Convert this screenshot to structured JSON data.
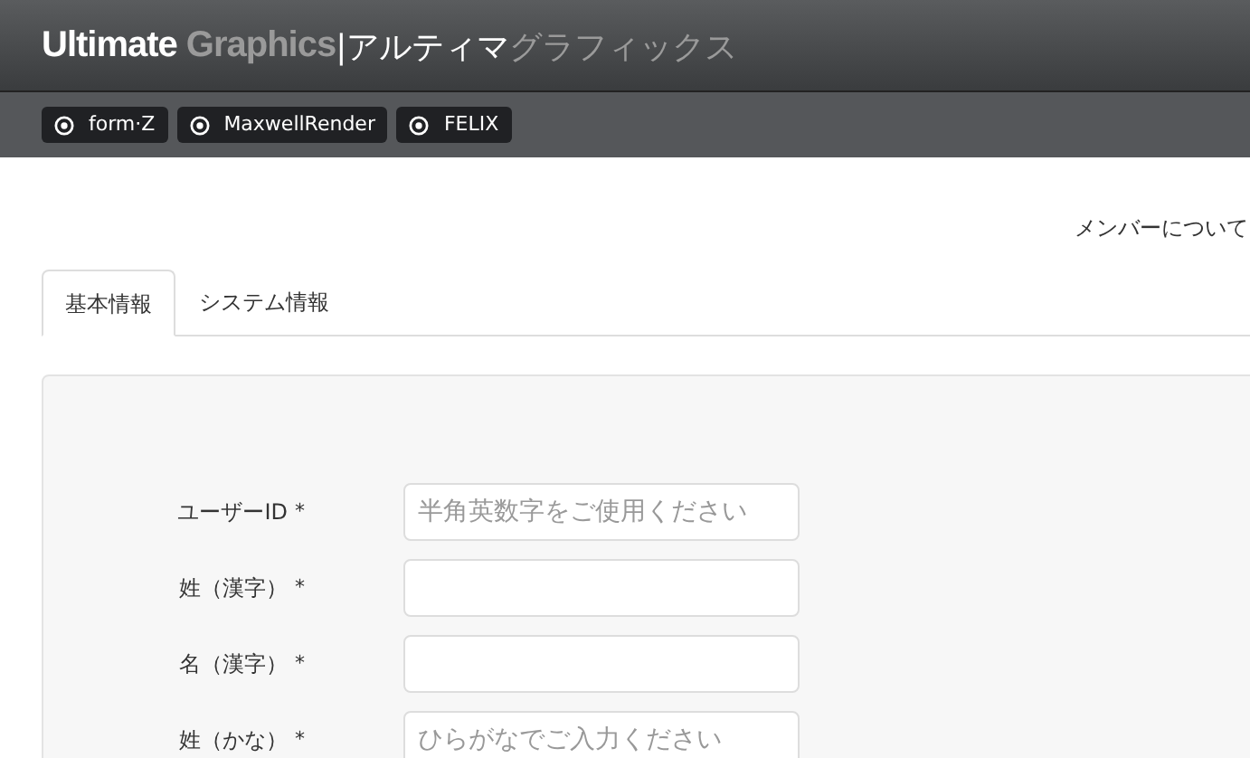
{
  "logo": [
    {
      "text": "Ultimate",
      "color": "#ffffff"
    },
    {
      "text": "Graphics",
      "color": "#9a9a9a"
    },
    {
      "text": "|",
      "color": "#ffffff"
    },
    {
      "text": "アルティマ",
      "color": "#ffffff"
    },
    {
      "text": "グラフィックス",
      "color": "#9a9a9a"
    }
  ],
  "nav": [
    {
      "label": "form·Z"
    },
    {
      "label": "MaxwellRender"
    },
    {
      "label": "FELIX"
    }
  ],
  "top_link": "メンバーについて",
  "tabs": [
    {
      "label": "基本情報",
      "selected": true
    },
    {
      "label": "システム情報",
      "selected": false
    }
  ],
  "fields": [
    {
      "label": "ユーザーID",
      "mark": "*",
      "placeholder": "半角英数字をご使用ください"
    },
    {
      "label": "姓（漢字）",
      "mark": "*"
    },
    {
      "label": "名（漢字）",
      "mark": "*"
    },
    {
      "label": "姓（かな）",
      "mark": "*",
      "placeholder": "ひらがなでご入力ください"
    }
  ]
}
